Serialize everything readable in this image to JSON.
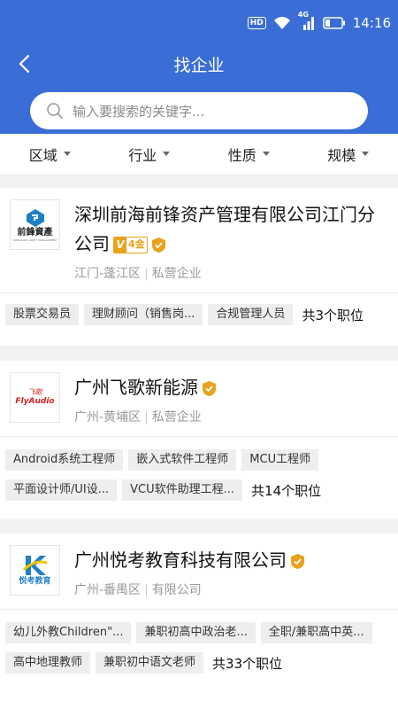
{
  "status": {
    "hd": "HD",
    "net": "4G",
    "time": "14:16"
  },
  "nav": {
    "title": "找企业"
  },
  "search": {
    "placeholder": "输入要搜索的关键字..."
  },
  "filters": [
    "区域",
    "行业",
    "性质",
    "规模"
  ],
  "colors": {
    "primary": "#3a6ed6",
    "badge": "#e9a21b"
  },
  "companies": [
    {
      "name": "深圳前海前锋资产管理有限公司江门分公司",
      "logo_text": "前鋒資產",
      "logo_sub": "VANGUARD ASSET MANAGEMENT",
      "badge": "4金",
      "location": "江门-蓬江区",
      "type": "私营企业",
      "tags_row1": [
        "股票交易员",
        "理财顾问（销售岗...",
        "合规管理人员"
      ],
      "tags_row2": [],
      "count": "共3个职位"
    },
    {
      "name": "广州飞歌新能源",
      "logo_text": "飞歌",
      "logo_sub": "FlyAudio",
      "location": "广州-黄埔区",
      "type": "私营企业",
      "tags_row1": [
        "Android系统工程师",
        "嵌入式软件工程师",
        "MCU工程师"
      ],
      "tags_row2": [
        "平面设计师/UI设...",
        "VCU软件助理工程..."
      ],
      "count": "共14个职位"
    },
    {
      "name": "广州悦考教育科技有限公司",
      "logo_text": "悦考教育",
      "location": "广州-番禺区",
      "type": "有限公司",
      "tags_row1": [
        "幼儿外教Children\"...",
        "兼职初高中政治老...",
        "全职/兼职高中英..."
      ],
      "tags_row2": [
        "高中地理教师",
        "兼职初中语文老师"
      ],
      "count": "共33个职位"
    }
  ]
}
